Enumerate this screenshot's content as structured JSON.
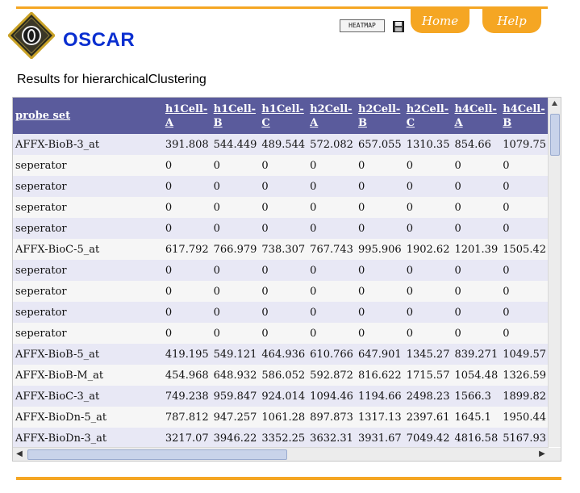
{
  "header": {
    "app_name": "OSCAR",
    "heatmap_label": "HEATMAP",
    "tabs": [
      "Home",
      "Help"
    ]
  },
  "page_title": "Results for hierarchicalClustering",
  "colors": {
    "accent": "#f5a623",
    "brand": "#0a2fd0",
    "table_header": "#5a5b9c",
    "row_alt": "#e8e8f5"
  },
  "table": {
    "columns": [
      "probe set",
      "h1Cell-A",
      "h1Cell-B",
      "h1Cell-C",
      "h2Cell-A",
      "h2Cell-B",
      "h2Cell-C",
      "h4Cell-A",
      "h4Cell-B"
    ],
    "rows": [
      [
        "AFFX-BioB-3_at",
        "391.808",
        "544.449",
        "489.544",
        "572.082",
        "657.055",
        "1310.35",
        "854.66",
        "1079.75"
      ],
      [
        "seperator",
        "0",
        "0",
        "0",
        "0",
        "0",
        "0",
        "0",
        "0"
      ],
      [
        "seperator",
        "0",
        "0",
        "0",
        "0",
        "0",
        "0",
        "0",
        "0"
      ],
      [
        "seperator",
        "0",
        "0",
        "0",
        "0",
        "0",
        "0",
        "0",
        "0"
      ],
      [
        "seperator",
        "0",
        "0",
        "0",
        "0",
        "0",
        "0",
        "0",
        "0"
      ],
      [
        "AFFX-BioC-5_at",
        "617.792",
        "766.979",
        "738.307",
        "767.743",
        "995.906",
        "1902.62",
        "1201.39",
        "1505.42"
      ],
      [
        "seperator",
        "0",
        "0",
        "0",
        "0",
        "0",
        "0",
        "0",
        "0"
      ],
      [
        "seperator",
        "0",
        "0",
        "0",
        "0",
        "0",
        "0",
        "0",
        "0"
      ],
      [
        "seperator",
        "0",
        "0",
        "0",
        "0",
        "0",
        "0",
        "0",
        "0"
      ],
      [
        "seperator",
        "0",
        "0",
        "0",
        "0",
        "0",
        "0",
        "0",
        "0"
      ],
      [
        "AFFX-BioB-5_at",
        "419.195",
        "549.121",
        "464.936",
        "610.766",
        "647.901",
        "1345.27",
        "839.271",
        "1049.57"
      ],
      [
        "AFFX-BioB-M_at",
        "454.968",
        "648.932",
        "586.052",
        "592.872",
        "816.622",
        "1715.57",
        "1054.48",
        "1326.59"
      ],
      [
        "AFFX-BioC-3_at",
        "749.238",
        "959.847",
        "924.014",
        "1094.46",
        "1194.66",
        "2498.23",
        "1566.3",
        "1899.82"
      ],
      [
        "AFFX-BioDn-5_at",
        "787.812",
        "947.257",
        "1061.28",
        "897.873",
        "1317.13",
        "2397.61",
        "1645.1",
        "1950.44"
      ],
      [
        "AFFX-BioDn-3_at",
        "3217.07",
        "3946.22",
        "3352.25",
        "3632.31",
        "3931.67",
        "7049.42",
        "4816.58",
        "5167.93"
      ]
    ]
  }
}
